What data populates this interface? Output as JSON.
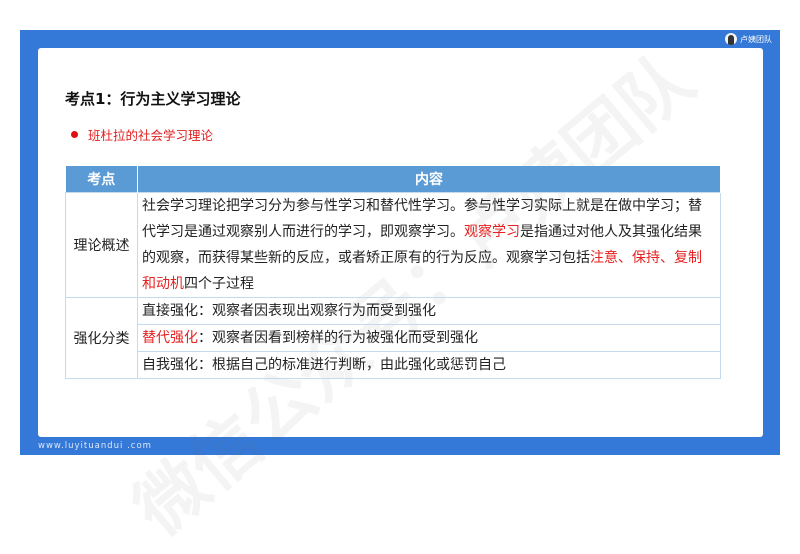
{
  "brand": "卢姨团队",
  "title": "考点1：行为主义学习理论",
  "bullet": "班杜拉的社会学习理论",
  "table": {
    "headers": [
      "考点",
      "内容"
    ],
    "row1": {
      "key": "理论概述",
      "parts": [
        "社会学习理论把学习分为参与性学习和替代性学习。参与性学习实际上就是在做中学习；替代学习是通过观察别人而进行的学习，即观察学习。",
        "观察学习",
        "是指通过对他人及其强化结果的观察，而获得某些新的反应，或者矫正原有的行为反应。观察学习包括",
        "注意、保持、复制和动机",
        "四个子过程"
      ]
    },
    "row2": {
      "key": "强化分类",
      "items": [
        {
          "label": "直接强化",
          "text": "：观察者因表现出观察行为而受到强化"
        },
        {
          "label": "替代强化",
          "text": "：观察者因看到榜样的行为被强化而受到强化"
        },
        {
          "label": "自我强化",
          "text": "：根据自己的标准进行判断，由此强化或惩罚自己"
        }
      ]
    }
  },
  "footer": "www.luyituandui .com",
  "watermark": "微信公众号：卢姨团队",
  "colors": {
    "frame": "#3478d8",
    "header": "#5b9bd5",
    "accent": "#e82020"
  }
}
